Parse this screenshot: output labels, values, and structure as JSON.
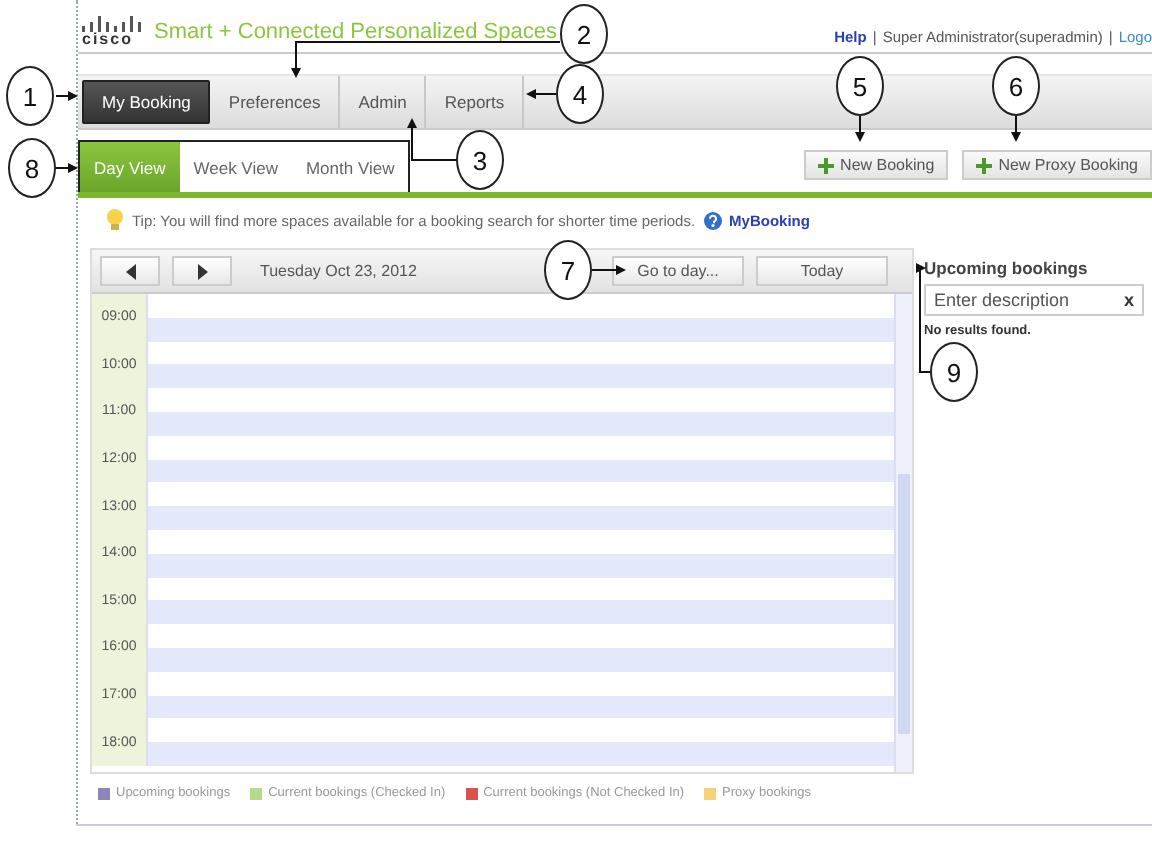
{
  "header": {
    "logo": "cisco",
    "title": "Smart + Connected Personalized Spaces",
    "links": [
      {
        "kind": "link",
        "label": "Help"
      },
      {
        "kind": "sep",
        "label": "|"
      },
      {
        "kind": "text",
        "label": "Super Administrator(superadmin)"
      },
      {
        "kind": "sep",
        "label": "|"
      },
      {
        "kind": "link",
        "label": "Logo"
      }
    ]
  },
  "nav_tabs": [
    {
      "label": "My Booking",
      "selected": true
    },
    {
      "label": "Preferences",
      "selected": false
    },
    {
      "label": "Admin",
      "selected": false
    },
    {
      "label": "Reports",
      "selected": false
    }
  ],
  "view_tabs": [
    {
      "label": "Day View",
      "selected": true
    },
    {
      "label": "Week View",
      "selected": false
    },
    {
      "label": "Month View",
      "selected": false
    }
  ],
  "actions": [
    {
      "label": "New Booking"
    },
    {
      "label": "New Proxy Booking"
    }
  ],
  "tip": {
    "text": "Tip: You will find more spaces available for a booking search for shorter time periods.",
    "link": "MyBooking"
  },
  "calendar": {
    "date": "Tuesday Oct 23, 2012",
    "buttons": [
      "Go to day...",
      "Today"
    ],
    "hours": [
      "09:00",
      "10:00",
      "11:00",
      "12:00",
      "13:00",
      "14:00",
      "15:00",
      "16:00",
      "17:00",
      "18:00"
    ]
  },
  "upcoming": {
    "title": "Upcoming bookings",
    "search": {
      "placeholder": "Enter description",
      "clear": "x"
    },
    "message": "No results found."
  },
  "legend": [
    {
      "label": "Upcoming bookings",
      "color": "#8e86b8"
    },
    {
      "label": "Current bookings (Checked In)",
      "color": "#b9d98a"
    },
    {
      "label": "Current bookings (Not Checked In)",
      "color": "#d9534f"
    },
    {
      "label": "Proxy bookings",
      "color": "#f5d27a"
    }
  ],
  "callouts": [
    "1",
    "2",
    "3",
    "4",
    "5",
    "6",
    "7",
    "8",
    "9"
  ]
}
